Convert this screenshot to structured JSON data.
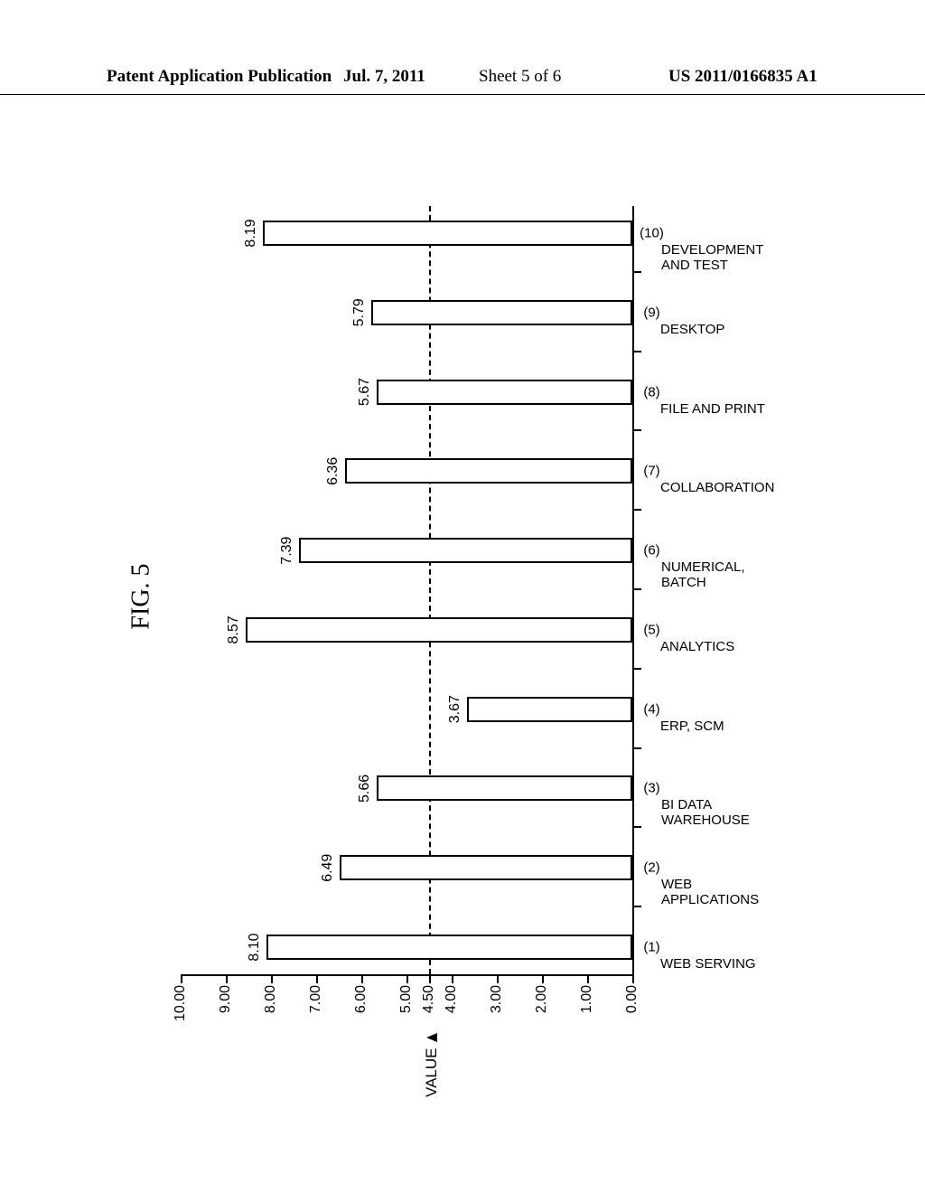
{
  "header": {
    "left": "Patent Application Publication",
    "date": "Jul. 7, 2011",
    "sheet": "Sheet 5 of 6",
    "pubno": "US 2011/0166835 A1"
  },
  "figure_label": "FIG. 5",
  "y_axis": {
    "title": "VALUE",
    "ticks": [
      "0.00",
      "1.00",
      "2.00",
      "3.00",
      "4.00",
      "4.50",
      "5.00",
      "6.00",
      "7.00",
      "8.00",
      "9.00",
      "10.00"
    ],
    "min": 0.0,
    "max": 10.0,
    "ref_line": 4.5
  },
  "chart_data": {
    "type": "bar",
    "title": "",
    "xlabel": "",
    "ylabel": "VALUE",
    "ylim": [
      0,
      10
    ],
    "categories": [
      {
        "num": "(1)",
        "lines": [
          "WEB SERVING"
        ]
      },
      {
        "num": "(2)",
        "lines": [
          "WEB",
          "APPLICATIONS"
        ]
      },
      {
        "num": "(3)",
        "lines": [
          "BI DATA",
          "WAREHOUSE"
        ]
      },
      {
        "num": "(4)",
        "lines": [
          "ERP, SCM"
        ]
      },
      {
        "num": "(5)",
        "lines": [
          "ANALYTICS"
        ]
      },
      {
        "num": "(6)",
        "lines": [
          "NUMERICAL,",
          "BATCH"
        ]
      },
      {
        "num": "(7)",
        "lines": [
          "COLLABORATION"
        ]
      },
      {
        "num": "(8)",
        "lines": [
          "FILE AND PRINT"
        ]
      },
      {
        "num": "(9)",
        "lines": [
          "DESKTOP"
        ]
      },
      {
        "num": "(10)",
        "lines": [
          "DEVELOPMENT",
          "AND TEST"
        ]
      }
    ],
    "values": [
      8.1,
      6.49,
      5.66,
      3.67,
      8.57,
      7.39,
      6.36,
      5.67,
      5.79,
      8.19
    ],
    "reference_line": 4.5
  }
}
